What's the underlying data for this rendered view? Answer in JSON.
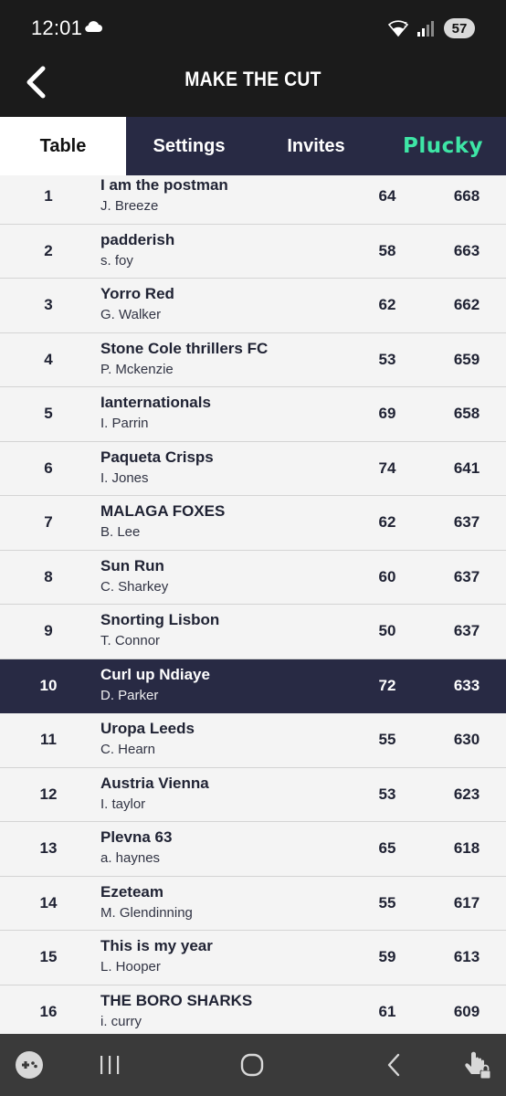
{
  "status_bar": {
    "time": "12:01",
    "battery": "57",
    "icons": [
      "cloud-icon",
      "wifi-icon",
      "signal-icon"
    ]
  },
  "header": {
    "title": "MAKE THE CUT",
    "back_icon": "chevron-left-icon"
  },
  "tabs": [
    {
      "label": "Table",
      "active": true
    },
    {
      "label": "Settings",
      "active": false
    },
    {
      "label": "Invites",
      "active": false
    },
    {
      "label": "Plucky",
      "active": false
    }
  ],
  "colors": {
    "header_bg": "#1b1b1b",
    "tab_bg": "#282a44",
    "highlight_row": "#282a44",
    "plucky_accent": "#3ee6a6"
  },
  "rows": [
    {
      "rank": "1",
      "team": "I am the postman",
      "manager": "J. Breeze",
      "gw": "64",
      "total": "668"
    },
    {
      "rank": "2",
      "team": "padderish",
      "manager": "s. foy",
      "gw": "58",
      "total": "663"
    },
    {
      "rank": "3",
      "team": "Yorro Red",
      "manager": "G. Walker",
      "gw": "62",
      "total": "662"
    },
    {
      "rank": "4",
      "team": "Stone Cole thrillers FC",
      "manager": "P. Mckenzie",
      "gw": "53",
      "total": "659"
    },
    {
      "rank": "5",
      "team": "Ianternationals",
      "manager": "I. Parrin",
      "gw": "69",
      "total": "658"
    },
    {
      "rank": "6",
      "team": "Paqueta Crisps",
      "manager": "I. Jones",
      "gw": "74",
      "total": "641"
    },
    {
      "rank": "7",
      "team": "MALAGA FOXES",
      "manager": "B. Lee",
      "gw": "62",
      "total": "637"
    },
    {
      "rank": "8",
      "team": "Sun Run",
      "manager": "C. Sharkey",
      "gw": "60",
      "total": "637"
    },
    {
      "rank": "9",
      "team": "Snorting Lisbon",
      "manager": "T. Connor",
      "gw": "50",
      "total": "637"
    },
    {
      "rank": "10",
      "team": "Curl up Ndiaye",
      "manager": "D. Parker",
      "gw": "72",
      "total": "633",
      "highlight": true
    },
    {
      "rank": "11",
      "team": "Uropa Leeds",
      "manager": "C. Hearn",
      "gw": "55",
      "total": "630"
    },
    {
      "rank": "12",
      "team": "Austria Vienna",
      "manager": "I. taylor",
      "gw": "53",
      "total": "623"
    },
    {
      "rank": "13",
      "team": "Plevna 63",
      "manager": "a. haynes",
      "gw": "65",
      "total": "618"
    },
    {
      "rank": "14",
      "team": "Ezeteam",
      "manager": "M. Glendinning",
      "gw": "55",
      "total": "617"
    },
    {
      "rank": "15",
      "team": "This is my year",
      "manager": "L. Hooper",
      "gw": "59",
      "total": "613"
    },
    {
      "rank": "16",
      "team": "THE BORO SHARKS",
      "manager": "i. curry",
      "gw": "61",
      "total": "609"
    }
  ],
  "nav_bar": {
    "icons": [
      "game-controller-icon",
      "recents-icon",
      "home-icon",
      "back-icon",
      "touch-lock-icon"
    ]
  }
}
